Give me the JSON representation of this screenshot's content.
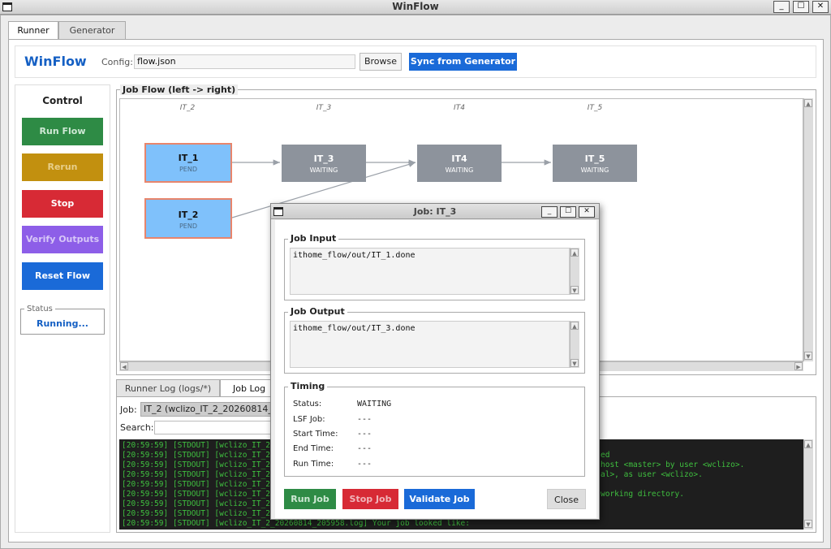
{
  "window": {
    "title": "WinFlow"
  },
  "tabs": [
    {
      "label": "Runner"
    },
    {
      "label": "Generator"
    }
  ],
  "header": {
    "brand": "WinFlow",
    "config_label": "Config:",
    "config_value": "flow.json",
    "browse_label": "Browse",
    "sync_label": "Sync from Generator"
  },
  "control": {
    "title": "Control",
    "buttons": {
      "run": "Run Flow",
      "rerun": "Rerun",
      "stop": "Stop",
      "verify": "Verify Outputs",
      "reset": "Reset Flow"
    },
    "status_legend": "Status",
    "status_value": "Running..."
  },
  "flow": {
    "legend": "Job Flow (left -> right)",
    "columns": [
      "IT_2",
      "IT_3",
      "IT4",
      "IT_5"
    ],
    "nodes": [
      {
        "name": "IT_1",
        "state": "PEND"
      },
      {
        "name": "IT_2",
        "state": "PEND"
      },
      {
        "name": "IT_3",
        "state": "WAITING"
      },
      {
        "name": "IT4",
        "state": "WAITING"
      },
      {
        "name": "IT_5",
        "state": "WAITING"
      }
    ]
  },
  "logs": {
    "tabs": [
      {
        "label": "Runner Log (logs/*)"
      },
      {
        "label": "Job Log (l"
      }
    ],
    "job_label": "Job:",
    "job_value": "IT_2  (wclizo_IT_2_20260814_20",
    "search_label": "Search:",
    "lines": [
      "[20:59:59] [STDOUT] [wclizo_IT_2",
      "[20:59:59] [STDOUT] [wclizo_IT_2",
      "[20:59:59] [STDOUT] [wclizo_IT_2",
      "[20:59:59] [STDOUT] [wclizo_IT_2",
      "[20:59:59] [STDOUT] [wclizo_IT_2",
      "[20:59:59] [STDOUT] [wclizo_IT_2",
      "[20:59:59] [STDOUT] [wclizo_IT_2",
      "[20:59:59] [STDOUT] [wclizo_IT_2",
      "[20:59:59] [STDOUT] [wclizo_IT_2_20260814_205958.log] Your job looked like:"
    ],
    "tails": [
      "ed",
      "host <master> by user <wclizo>.",
      "al>, as user <wclizo>.",
      "working directory."
    ]
  },
  "modal": {
    "title": "Job: IT_3",
    "input_legend": "Job Input",
    "input_value": "ithome_flow/out/IT_1.done",
    "output_legend": "Job Output",
    "output_value": "ithome_flow/out/IT_3.done",
    "timing_legend": "Timing",
    "timing": [
      {
        "label": "Status:",
        "value": "WAITING"
      },
      {
        "label": "LSF Job:",
        "value": "---"
      },
      {
        "label": "Start Time:",
        "value": "---"
      },
      {
        "label": "End Time:",
        "value": "---"
      },
      {
        "label": "Run Time:",
        "value": "---"
      }
    ],
    "buttons": {
      "run": "Run Job",
      "stop": "Stop Job",
      "validate": "Validate Job",
      "close": "Close"
    }
  }
}
